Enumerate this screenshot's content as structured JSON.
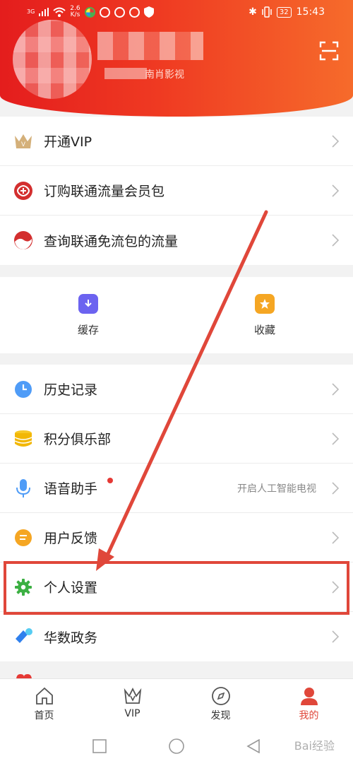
{
  "status_bar": {
    "network": "3G",
    "speed_value": "2.6",
    "speed_unit": "K/s",
    "battery": "32",
    "time": "15:43"
  },
  "header": {
    "subtitle": "南肖影视"
  },
  "menu_top": [
    {
      "label": "开通VIP",
      "icon": "crown-icon"
    },
    {
      "label": "订购联通流量会员包",
      "icon": "unicom-knot-icon"
    },
    {
      "label": "查询联通免流包的流量",
      "icon": "unicom-wave-icon"
    }
  ],
  "quick_cards": [
    {
      "label": "缓存",
      "icon": "download-icon",
      "color": "#6c63f0"
    },
    {
      "label": "收藏",
      "icon": "star-icon",
      "color": "#f5a623"
    }
  ],
  "menu_bottom": [
    {
      "label": "历史记录",
      "icon": "clock-icon",
      "extra": ""
    },
    {
      "label": "积分俱乐部",
      "icon": "coins-icon",
      "extra": ""
    },
    {
      "label": "语音助手",
      "icon": "microphone-icon",
      "extra": "开启人工智能电视"
    },
    {
      "label": "用户反馈",
      "icon": "feedback-icon",
      "extra": ""
    },
    {
      "label": "个人设置",
      "icon": "gear-icon",
      "extra": ""
    },
    {
      "label": "华数政务",
      "icon": "government-icon",
      "extra": ""
    }
  ],
  "tabbar": [
    {
      "label": "首页",
      "icon": "home-icon"
    },
    {
      "label": "VIP",
      "icon": "vip-crown-icon"
    },
    {
      "label": "发现",
      "icon": "compass-icon"
    },
    {
      "label": "我的",
      "icon": "person-icon",
      "active": true
    }
  ],
  "colors": {
    "header_start": "#e41d1d",
    "header_end": "#f66b2b",
    "accent": "#e0473a"
  },
  "watermark": "Bai经验"
}
